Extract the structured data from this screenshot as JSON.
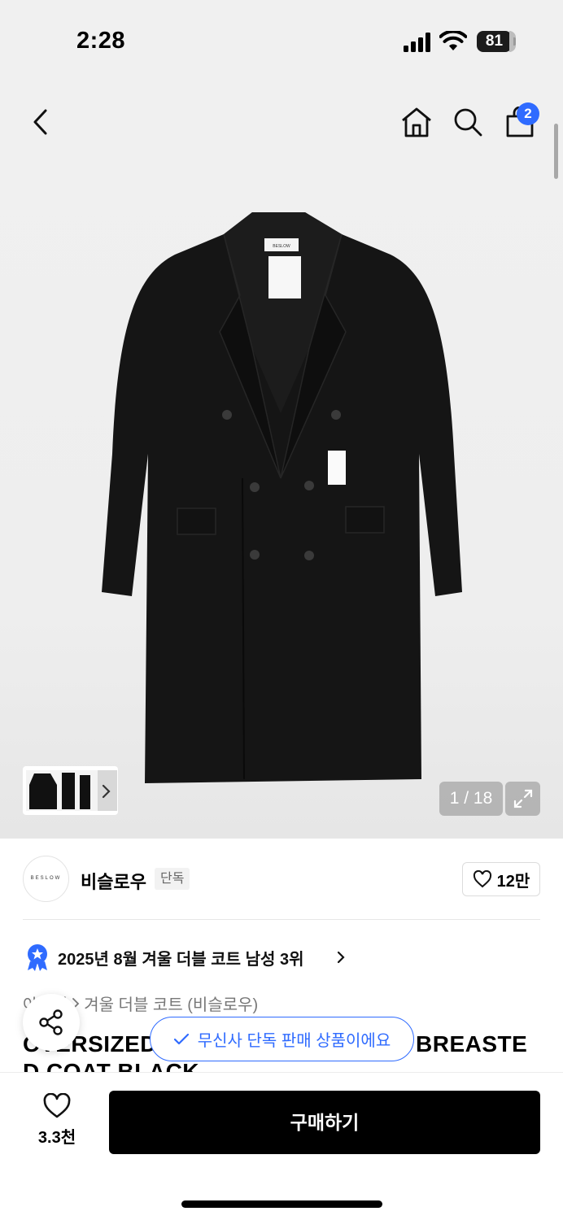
{
  "status_bar": {
    "time": "2:28",
    "battery": "81",
    "battery_level": 0.81
  },
  "nav": {
    "back_icon": "chevron-left-icon",
    "home_icon": "home-icon",
    "search_icon": "search-icon",
    "cart_icon": "shopping-bag-icon",
    "cart_count": "2"
  },
  "gallery": {
    "page_counter": "1 / 18",
    "current_page": 1,
    "total_pages": 18,
    "product_image_label": "BESLOW"
  },
  "brand": {
    "logo_text": "BESLOW",
    "name": "비슬로우",
    "badge": "단독",
    "like_count": "12만"
  },
  "ranking": {
    "text": "2025년 8월 겨울 더블 코트 남성 3위"
  },
  "breadcrumb": {
    "category_partial": "아우터",
    "subcategory": "겨울 더블 코트 (비슬로우)"
  },
  "product": {
    "title_line1_visible_start": "O",
    "title_line1_start_hidden": "VERSIZED",
    "title_line1_end": "BREASTE",
    "title_line2": "D COAT BLACK"
  },
  "toast": {
    "text": "무신사 단독 판매 상품이에요"
  },
  "bottom_bar": {
    "wish_count": "3.3천",
    "buy_label": "구매하기"
  },
  "colors": {
    "accent": "#2f6bff",
    "buy_button": "#000000",
    "badge": "#2f6bff"
  }
}
